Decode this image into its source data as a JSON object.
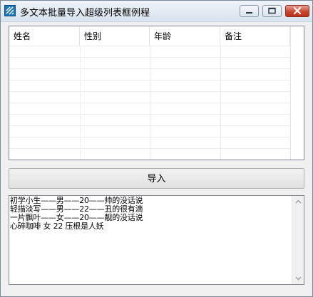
{
  "window": {
    "title": "多文本批量导入超级列表框例程"
  },
  "listview": {
    "columns": [
      "姓名",
      "性别",
      "年龄",
      "备注"
    ]
  },
  "import_button": {
    "label": "导入"
  },
  "textbox": {
    "lines": [
      "初学小生——男——20——帅的没话说",
      "轻描淡写——男——22——丑的很有滴",
      "一片飘叶——女——20——靓的没话说",
      "心碎咖啡 女 22 压根是人妖"
    ]
  }
}
